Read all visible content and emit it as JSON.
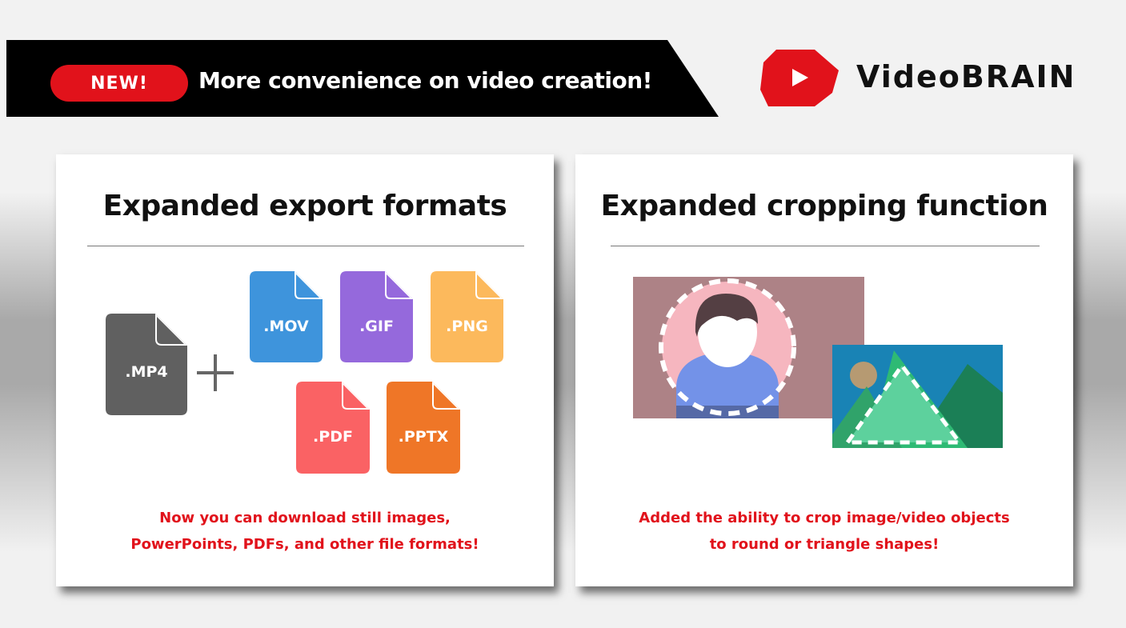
{
  "banner": {
    "badge": "NEW!",
    "headline": "More convenience on video creation!"
  },
  "brand": {
    "name": "VideoBRAIN",
    "logo_icon": "play-hexagon-logo",
    "color": "#e1121b"
  },
  "export_card": {
    "title": "Expanded export formats",
    "caption_lines": [
      "Now you can download still images,",
      "PowerPoints, PDFs, and other file formats!"
    ],
    "files": [
      {
        "label": ".MP4",
        "color": "#606060"
      },
      {
        "label": ".MOV",
        "color": "#3e94dc"
      },
      {
        "label": ".GIF",
        "color": "#9569dc"
      },
      {
        "label": ".PNG",
        "color": "#fcb95c"
      },
      {
        "label": ".PDF",
        "color": "#fa6264"
      },
      {
        "label": ".PPTX",
        "color": "#ef7627"
      }
    ],
    "plus_icon": "plus-icon"
  },
  "crop_card": {
    "title": "Expanded cropping function",
    "caption_lines": [
      "Added the ability to crop image/video objects",
      "to round or triangle shapes!"
    ]
  },
  "colors": {
    "accent_red": "#e1121b",
    "banner_bg": "#000000"
  }
}
